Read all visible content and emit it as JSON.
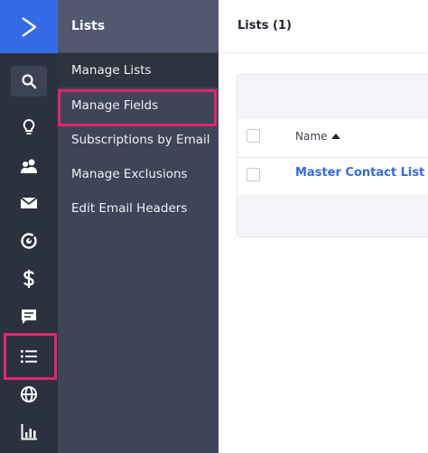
{
  "rail": {
    "items": [
      {
        "name": "search-icon"
      },
      {
        "name": "lightbulb-icon"
      },
      {
        "name": "contacts-icon"
      },
      {
        "name": "mail-icon"
      },
      {
        "name": "target-icon"
      },
      {
        "name": "dollar-icon"
      },
      {
        "name": "chat-icon"
      },
      {
        "name": "list-icon"
      },
      {
        "name": "globe-icon"
      },
      {
        "name": "bar-chart-icon"
      }
    ],
    "active": "list-icon"
  },
  "subnav": {
    "title": "Lists",
    "items": [
      {
        "label": "Manage Lists"
      },
      {
        "label": "Manage Fields"
      },
      {
        "label": "Subscriptions by Email"
      },
      {
        "label": "Manage Exclusions"
      },
      {
        "label": "Edit Email Headers"
      }
    ]
  },
  "main": {
    "title": "Lists (1)",
    "table": {
      "columns": [
        "Name"
      ],
      "rows": [
        {
          "name": "Master Contact List"
        }
      ]
    }
  },
  "colors": {
    "brand_blue": "#356ae6",
    "rail_bg": "#2c3140",
    "subnav_bg": "#3e4558",
    "highlight": "#e3266c"
  }
}
